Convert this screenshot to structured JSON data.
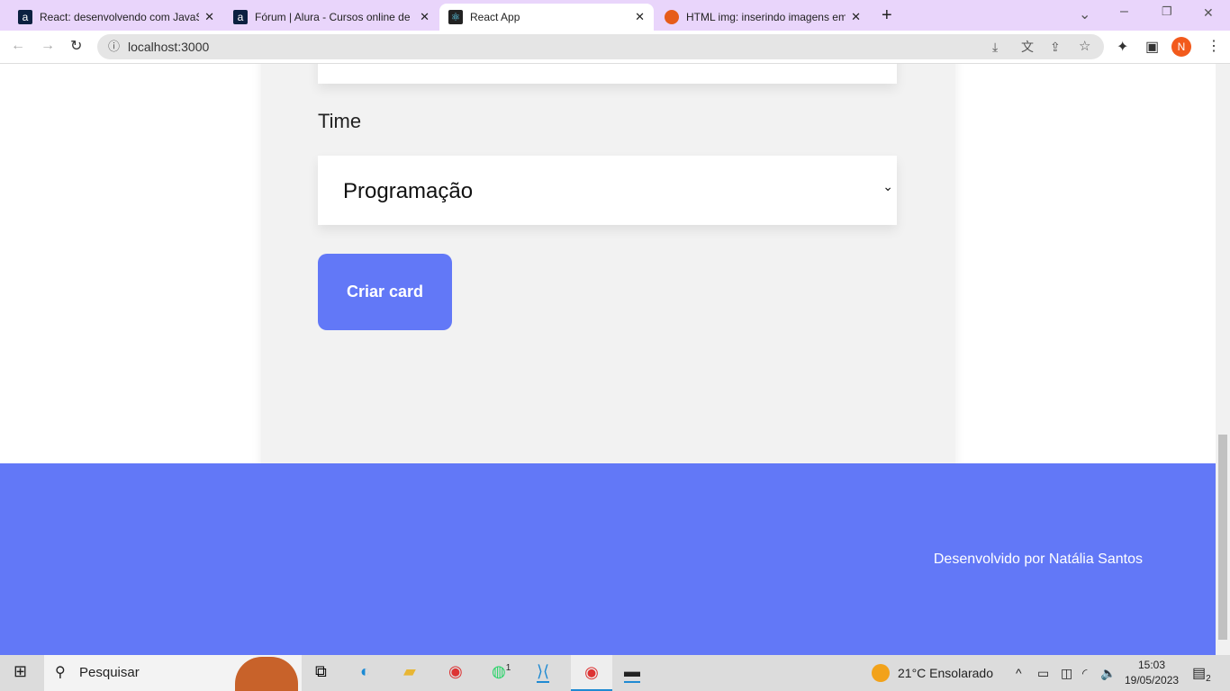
{
  "tabs": [
    {
      "title": "React: desenvolvendo com JavaS",
      "icon": "alura-icon"
    },
    {
      "title": "Fórum | Alura - Cursos online de",
      "icon": "alura-icon"
    },
    {
      "title": "React App",
      "icon": "react-icon",
      "active": true
    },
    {
      "title": "HTML img: inserindo imagens em",
      "icon": "mdn-icon"
    }
  ],
  "address": "localhost:3000",
  "profile_initial": "N",
  "form": {
    "team_label": "Time",
    "team_value": "Programação",
    "submit": "Criar card"
  },
  "footer": {
    "credit": "Desenvolvido por Natália Santos"
  },
  "taskbar": {
    "search_placeholder": "Pesquisar",
    "weather": "21°C  Ensolarado",
    "time": "15:03",
    "date": "19/05/2023",
    "notifications": "2",
    "whatsapp_badge": "1"
  },
  "colors": {
    "accent": "#6278f7",
    "tabbar": "#e9d5fb"
  }
}
